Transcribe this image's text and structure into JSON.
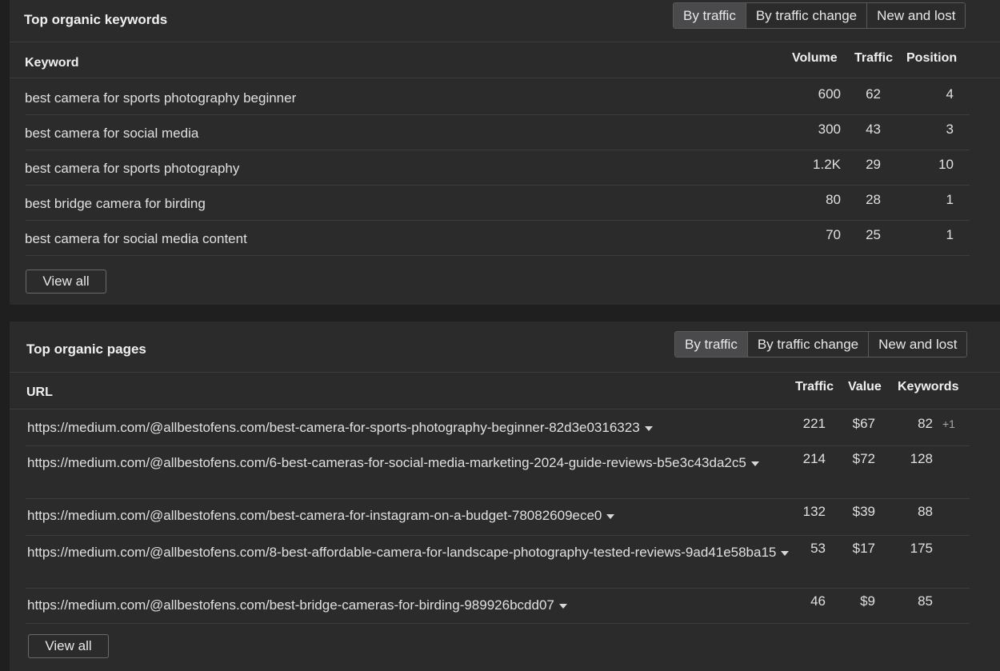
{
  "keywords_panel": {
    "title": "Top organic keywords",
    "tabs": [
      "By traffic",
      "By traffic change",
      "New and lost"
    ],
    "active_tab": "By traffic",
    "columns": {
      "keyword": "Keyword",
      "volume": "Volume",
      "traffic": "Traffic",
      "position": "Position"
    },
    "rows": [
      {
        "keyword": "best camera for sports photography beginner",
        "volume": "600",
        "traffic": "62",
        "position": "4"
      },
      {
        "keyword": "best camera for social media",
        "volume": "300",
        "traffic": "43",
        "position": "3"
      },
      {
        "keyword": "best camera for sports photography",
        "volume": "1.2K",
        "traffic": "29",
        "position": "10"
      },
      {
        "keyword": "best bridge camera for birding",
        "volume": "80",
        "traffic": "28",
        "position": "1"
      },
      {
        "keyword": "best camera for social media content",
        "volume": "70",
        "traffic": "25",
        "position": "1"
      }
    ],
    "view_all": "View all"
  },
  "pages_panel": {
    "title": "Top organic pages",
    "tabs": [
      "By traffic",
      "By traffic change",
      "New and lost"
    ],
    "active_tab": "By traffic",
    "columns": {
      "url": "URL",
      "traffic": "Traffic",
      "value": "Value",
      "keywords": "Keywords"
    },
    "rows": [
      {
        "url": "https://medium.com/@allbestofens.com/best-camera-for-sports-photography-beginner-82d3e0316323",
        "traffic": "221",
        "value": "$67",
        "keywords": "82",
        "extra": "+1"
      },
      {
        "url": "https://medium.com/@allbestofens.com/6-best-cameras-for-social-media-marketing-2024-guide-reviews-b5e3c43da2c5",
        "traffic": "214",
        "value": "$72",
        "keywords": "128",
        "extra": ""
      },
      {
        "url": "https://medium.com/@allbestofens.com/best-camera-for-instagram-on-a-budget-78082609ece0",
        "traffic": "132",
        "value": "$39",
        "keywords": "88",
        "extra": ""
      },
      {
        "url": "https://medium.com/@allbestofens.com/8-best-affordable-camera-for-landscape-photography-tested-reviews-9ad41e58ba15",
        "traffic": "53",
        "value": "$17",
        "keywords": "175",
        "extra": ""
      },
      {
        "url": "https://medium.com/@allbestofens.com/best-bridge-cameras-for-birding-989926bcdd07",
        "traffic": "46",
        "value": "$9",
        "keywords": "85",
        "extra": ""
      }
    ],
    "view_all": "View all"
  },
  "icons": {
    "url_expand": "caret-down-icon"
  },
  "colors": {
    "background": "#1f1f1f",
    "panel": "#2b2b2c",
    "active_tab": "#4a4a4c",
    "border": "#5a5a5a",
    "text": "#e0e0e0"
  }
}
